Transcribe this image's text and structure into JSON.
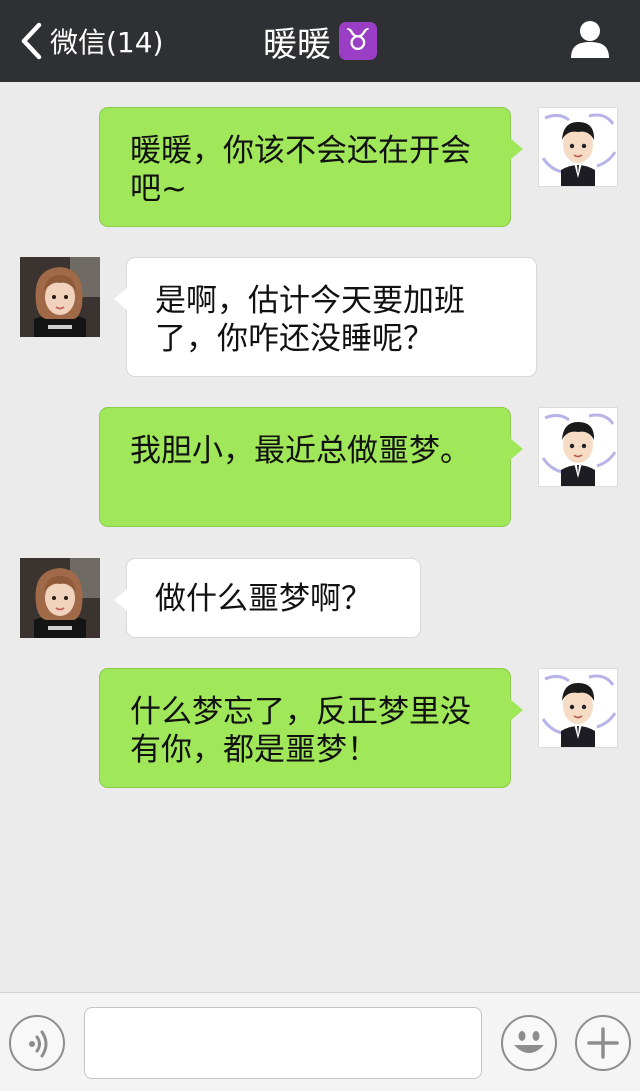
{
  "header": {
    "back_label": "微信(14)",
    "title": "暖暖",
    "title_badge": "♉",
    "icons": {
      "back": "chevron-left-icon",
      "profile": "person-icon"
    }
  },
  "messages": [
    {
      "sender": "me",
      "text": "暖暖，你该不会还在开会吧~"
    },
    {
      "sender": "her",
      "text": "是啊，估计今天要加班了，你咋还没睡呢？"
    },
    {
      "sender": "me",
      "text": "我胆小，最近总做噩梦。"
    },
    {
      "sender": "her",
      "text": "做什么噩梦啊？"
    },
    {
      "sender": "me",
      "text": "什么梦忘了，反正梦里没有你，都是噩梦！"
    }
  ],
  "input_bar": {
    "text_value": "",
    "icons": {
      "voice": "voice-icon",
      "emoji": "smiley-icon",
      "more": "plus-icon"
    }
  },
  "colors": {
    "header_bg": "#2f3034",
    "chat_bg": "#ebebeb",
    "my_bubble": "#a0e75a",
    "her_bubble": "#ffffff",
    "badge_purple": "#9b3ec6"
  }
}
